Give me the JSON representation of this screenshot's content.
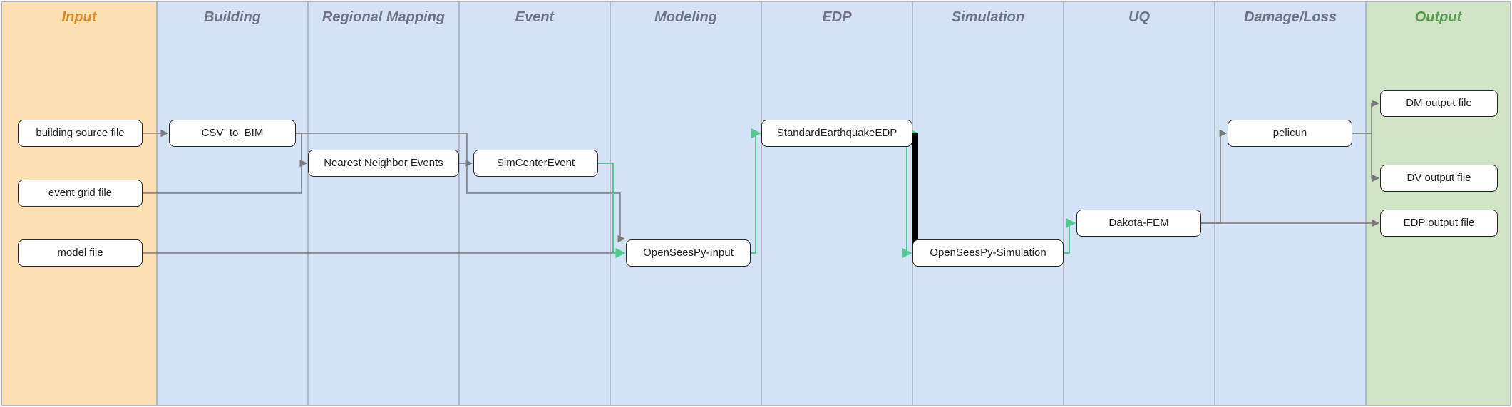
{
  "columns": {
    "input": {
      "title": "Input"
    },
    "building": {
      "title": "Building"
    },
    "regional": {
      "title": "Regional Mapping"
    },
    "event": {
      "title": "Event"
    },
    "modeling": {
      "title": "Modeling"
    },
    "edp": {
      "title": "EDP"
    },
    "simulation": {
      "title": "Simulation"
    },
    "uq": {
      "title": "UQ"
    },
    "damage": {
      "title": "Damage/Loss"
    },
    "output": {
      "title": "Output"
    }
  },
  "nodes": {
    "building_source_file": "building source file",
    "event_grid_file": "event grid file",
    "model_file": "model file",
    "csv_to_bim": "CSV_to_BIM",
    "nearest_neighbor": "Nearest Neighbor Events",
    "simcenter_event": "SimCenterEvent",
    "openseespy_input": "OpenSeesPy-Input",
    "standard_eq_edp": "StandardEarthquakeEDP",
    "openseespy_sim": "OpenSeesPy-Simulation",
    "dakota_fem": "Dakota-FEM",
    "pelicun": "pelicun",
    "dm_output": "DM output file",
    "dv_output": "DV output file",
    "edp_output": "EDP output file"
  }
}
